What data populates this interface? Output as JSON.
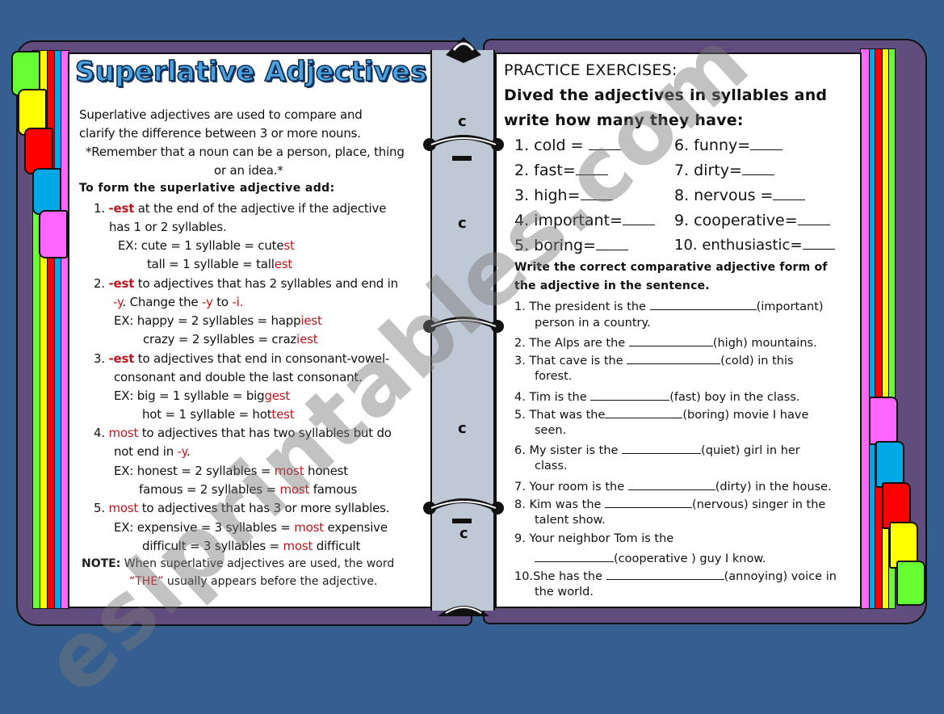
{
  "colors": {
    "background": "#365f91",
    "binder_cover": "#614c7e",
    "spine": "#bfc9d6",
    "title_fill": "#4aa3df",
    "accent_red": "#c0141c",
    "tab_colors": [
      "#66ff33",
      "#ffff00",
      "#ff0000",
      "#00a9e6",
      "#ff66ff"
    ]
  },
  "left_page": {
    "title": "Superlative Adjectives",
    "intro": [
      "Superlative  adjectives are used to  compare and",
      "clarify the difference between 3 or more nouns.",
      "*Remember that a noun can be a person, place, thing",
      "or an idea.*"
    ],
    "rule_heading": "To form the superlative adjective add:",
    "rules": [
      {
        "num": "1.",
        "key": "-est",
        "text_a": " at the end of the adjective if the adjective",
        "text_b": "has 1 or 2 syllables.",
        "examples": [
          {
            "pre": "EX: cute = 1 syllable = cute",
            "suffix": "st",
            "post": ""
          },
          {
            "pre": "tall = 1 syllable = tall",
            "suffix": "est",
            "post": ""
          }
        ]
      },
      {
        "num": "2.",
        "key": "-est",
        "text_a": " to adjectives that has 2 syllables and end in",
        "line2": {
          "y1": "-y",
          "mid": ". Change the ",
          "y2": "-y",
          "to": " to ",
          "i": "-i."
        },
        "examples": [
          {
            "pre": "EX: happy = 2 syllables = happ",
            "suffix": "iest",
            "post": ""
          },
          {
            "pre": "crazy = 2 syllables = craz",
            "suffix": "iest",
            "post": ""
          }
        ]
      },
      {
        "num": "3.",
        "key": "-est",
        "text_a": " to adjectives that end in consonant-vowel-",
        "text_b": "consonant and double the last consonant.",
        "examples": [
          {
            "pre": "EX: big = 1 syllable = big",
            "suffix": "gest",
            "post": ""
          },
          {
            "pre": "hot = 1 syllable = hot",
            "suffix": "test",
            "post": ""
          }
        ]
      },
      {
        "num": "4.",
        "key": "most",
        "text_a": " to adjectives that has two syllables but do",
        "line2": {
          "pre": "not end in ",
          "y": "-y",
          "post": "."
        },
        "examples": [
          {
            "pre": "EX: honest = 2 syllables = ",
            "suffix": "most",
            "post": " honest"
          },
          {
            "pre": "famous = 2 syllables = ",
            "suffix": "most",
            "post": " famous"
          }
        ]
      },
      {
        "num": "5.",
        "key": "most",
        "text_a": " to adjectives that has 3 or more syllables.",
        "examples": [
          {
            "pre": "EX:  expensive = 3 syllables = ",
            "suffix": "most",
            "post": " expensive"
          },
          {
            "pre": "difficult = 3 syllables = ",
            "suffix": "most",
            "post": " difficult"
          }
        ]
      }
    ],
    "note": {
      "label": "NOTE:",
      "line1": " When superlative  adjectives are used, the word",
      "the_word": "“THE”",
      "line2": " usually appears before the adjective."
    }
  },
  "right_page": {
    "heading": "PRACTICE EXERCISES:",
    "instruction1": [
      "Dived the adjectives in syllables and",
      "write how many they have:"
    ],
    "syllable_items_left": [
      "1.  cold = ",
      "2.  fast=",
      "3.  high=",
      "4.  important=",
      "5.  boring="
    ],
    "syllable_items_right": [
      "6. funny=",
      "7. dirty=",
      "8. nervous =",
      "9. cooperative=",
      "10.  enthusiastic="
    ],
    "instruction2": [
      "Write the correct comparative adjective form of",
      "the adjective in the sentence."
    ],
    "sentences": [
      {
        "num": "1.",
        "before": "The president is the  ",
        "hint": "(important)",
        "after": "",
        "cont": "person in a country."
      },
      {
        "num": "2.",
        "before": "The Alps are the  ",
        "hint": "(high)",
        "after": " mountains.",
        "cont": ""
      },
      {
        "num": "3.",
        "before": "That cave is the  ",
        "hint": "(cold)",
        "after": " in this",
        "cont": "forest."
      },
      {
        "num": "4.",
        "before": "Tim is the  ",
        "hint": "(fast)",
        "after": " boy in the class.",
        "cont": ""
      },
      {
        "num": "5.",
        "before": "That was the",
        "hint": "(boring)",
        "after": " movie I have",
        "cont": "seen."
      },
      {
        "num": "6.",
        "before": "My sister is the  ",
        "hint": "(quiet)",
        "after": " girl in her",
        "cont": "class."
      },
      {
        "num": "7.",
        "before": "Your room is the ",
        "hint": "(dirty)",
        "after": " in the house.",
        "cont": ""
      },
      {
        "num": "8.",
        "before": "Kim was the ",
        "hint": "(nervous)",
        "after": " singer in the",
        "cont": "talent show."
      },
      {
        "num": "9.",
        "before": "Your neighbor Tom is the",
        "hint": "",
        "after": "",
        "cont_hint": "(cooperative )",
        "cont_after": " guy  I know."
      },
      {
        "num": "10.",
        "before": "She has the ",
        "hint": "(annoying)",
        "after": " voice in",
        "cont": "the world."
      }
    ]
  },
  "watermark": "eslprintables.com"
}
